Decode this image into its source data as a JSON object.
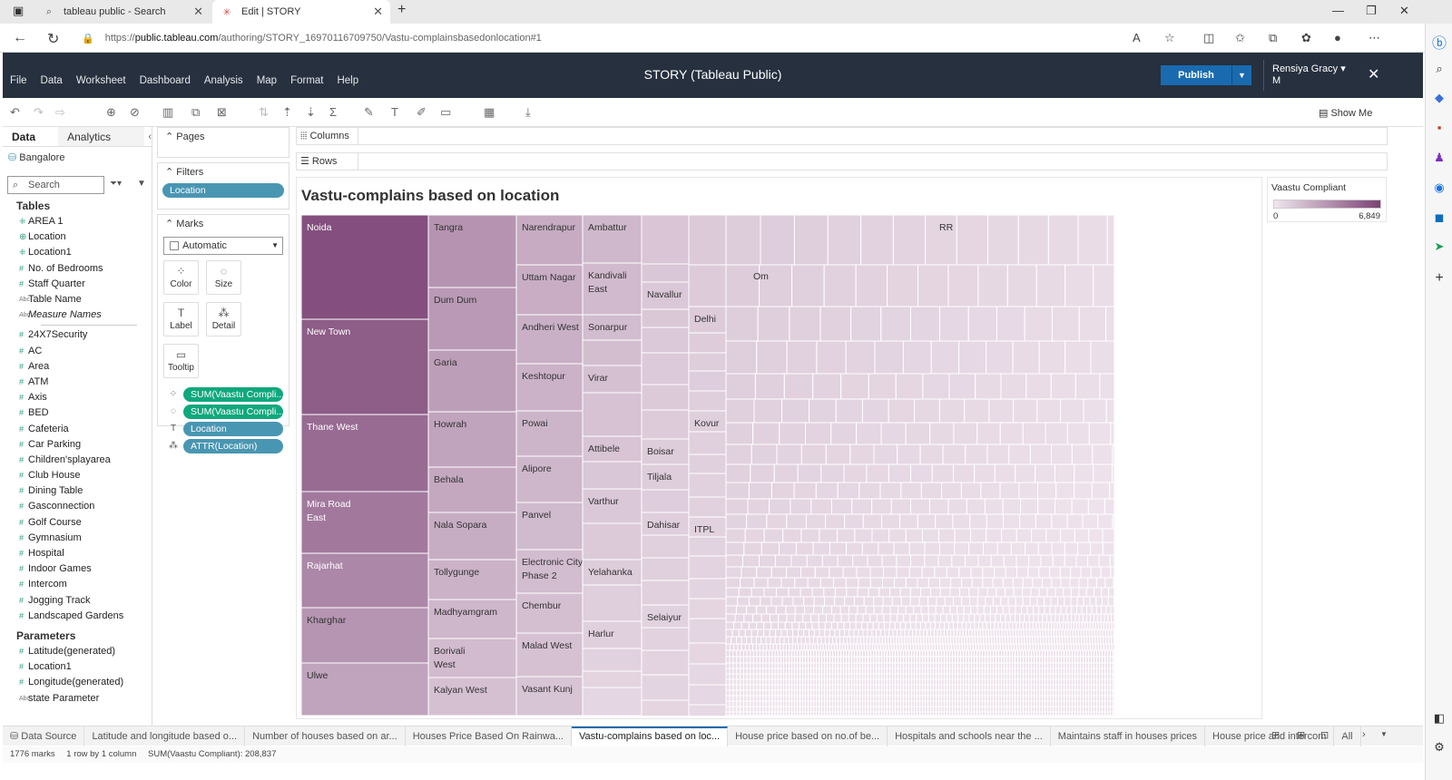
{
  "browser": {
    "tabs": [
      {
        "icon": "⌕",
        "title": "tableau public - Search"
      },
      {
        "icon": "✳",
        "title": "Edit | STORY"
      }
    ],
    "url_scheme": "https://",
    "url_host": "public.tableau.com",
    "url_path": "/authoring/STORY_16970116709750/Vastu-complainsbasedonlocation#1"
  },
  "app": {
    "title": "STORY (Tableau Public)",
    "menu": [
      "File",
      "Data",
      "Worksheet",
      "Dashboard",
      "Analysis",
      "Map",
      "Format",
      "Help"
    ],
    "publish_label": "Publish",
    "user_line1": "Rensiya Gracy",
    "user_line2": "M",
    "show_me": "Show Me"
  },
  "data_pane": {
    "tab_data": "Data",
    "tab_analytics": "Analytics",
    "datasource": "Bangalore",
    "search_placeholder": "Search",
    "tables_header": "Tables",
    "fields": [
      {
        "type": "dim",
        "name": "AREA 1"
      },
      {
        "type": "globe",
        "name": "Location"
      },
      {
        "type": "dim",
        "name": "Location1"
      },
      {
        "type": "num",
        "name": "No. of Bedrooms"
      },
      {
        "type": "num",
        "name": "Staff Quarter"
      },
      {
        "type": "abc",
        "name": "Table Name"
      },
      {
        "type": "abc",
        "name": "Measure Names"
      }
    ],
    "measures": [
      "24X7Security",
      "AC",
      "Area",
      "ATM",
      "Axis",
      "BED",
      "Cafeteria",
      "Car Parking",
      "Children'splayarea",
      "Club House",
      "Dining Table",
      "Gasconnection",
      "Golf Course",
      "Gymnasium",
      "Hospital",
      "Indoor Games",
      "Intercom",
      "Jogging Track",
      "Landscaped Gardens"
    ],
    "parameters_header": "Parameters",
    "parameters": [
      {
        "type": "num",
        "name": "Latitude(generated)"
      },
      {
        "type": "num",
        "name": "Location1"
      },
      {
        "type": "num",
        "name": "Longitude(generated)"
      },
      {
        "type": "abc",
        "name": "state Parameter"
      }
    ]
  },
  "shelves": {
    "pages": "Pages",
    "filters": "Filters",
    "filter_pill": "Location",
    "marks": "Marks",
    "mark_type": "Automatic",
    "mark_buttons": [
      {
        "icon": "⁘",
        "label": "Color"
      },
      {
        "icon": "◌",
        "label": "Size"
      },
      {
        "icon": "T",
        "label": "Label"
      },
      {
        "icon": "⁂",
        "label": "Detail"
      },
      {
        "icon": "▭",
        "label": "Tooltip"
      }
    ],
    "mark_pills": [
      {
        "icon": "⁘",
        "label": "SUM(Vaastu Compli...",
        "color": "green"
      },
      {
        "icon": "◌",
        "label": "SUM(Vaastu Compli...",
        "color": "green"
      },
      {
        "icon": "T",
        "label": "Location",
        "color": "blue"
      },
      {
        "icon": "⁂",
        "label": "ATTR(Location)",
        "color": "blue"
      }
    ],
    "columns": "Columns",
    "rows": "Rows"
  },
  "view": {
    "title": "Vastu-complains based on location"
  },
  "legend": {
    "title": "Vaastu Compliant",
    "min": "0",
    "max": "6,849"
  },
  "sheet_tabs": [
    "Data Source",
    "Latitude and longitude based o...",
    "Number of houses based on ar...",
    "Houses Price Based On Rainwa...",
    "Vastu-complains based on loc...",
    "House price based on no.of be...",
    "Hospitals and schools near the ...",
    "Maintains staff in houses prices",
    "House price and intercom",
    "All"
  ],
  "active_sheet_index": 4,
  "status": {
    "marks": "1776 marks",
    "dims": "1 row by 1 column",
    "sum": "SUM(Vaastu Compliant): 208,837"
  },
  "chart_data": {
    "type": "treemap",
    "title": "Vastu-complains based on location",
    "color_measure": "Vaastu Compliant",
    "color_range": [
      0,
      6849
    ],
    "total": 208837,
    "mark_count": 1776,
    "colors": {
      "low": "#f0e6ee",
      "high": "#7b4274"
    },
    "columns": [
      {
        "labels": [
          "Noida",
          "New Town",
          "Thane West",
          "Mira Road East",
          "Rajarhat",
          "Kharghar",
          "Ulwe"
        ]
      },
      {
        "labels": [
          "Tangra",
          "Dum Dum",
          "Garia",
          "Howrah",
          "Behala",
          "Nala Sopara",
          "Tollygunge",
          "Madhyamgram",
          "Borivali West",
          "Kalyan West"
        ]
      },
      {
        "labels": [
          "Narendrapur",
          "Uttam Nagar",
          "Andheri West",
          "Keshtopur",
          "Powai",
          "Alipore",
          "Panvel",
          "Electronic City Phase 2",
          "Chembur",
          "Malad West",
          "Vasant Kunj"
        ]
      },
      {
        "labels": [
          "Ambattur",
          "Kandivali East",
          "Sonarpur",
          "Virar",
          "Attibele",
          "Varthur",
          "Yelahanka",
          "Harlur"
        ]
      },
      {
        "labels": [
          "Navallur",
          "Boisar",
          "Tiljala",
          "Dahisar",
          "Selaiyur"
        ]
      },
      {
        "labels": [
          "Delhi",
          "Kovur",
          "ITPL"
        ]
      },
      {
        "labels": [
          "Om",
          "RR"
        ]
      }
    ]
  }
}
